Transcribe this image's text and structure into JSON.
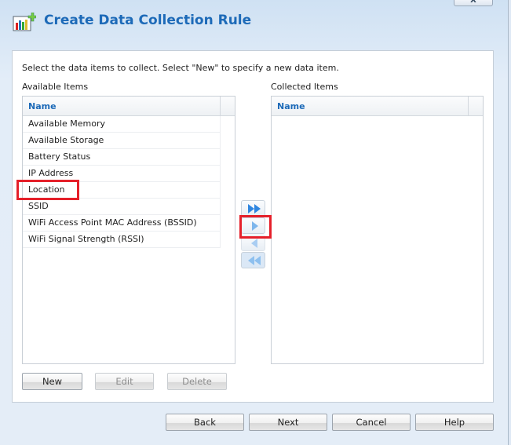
{
  "dialog": {
    "title": "Create Data Collection Rule",
    "close_label": "X",
    "app_icon": "chart-add-icon"
  },
  "instruction": "Select the data items to collect. Select \"New\" to specify a new data item.",
  "available": {
    "label": "Available Items",
    "column": "Name",
    "items": [
      "Available Memory",
      "Available Storage",
      "Battery Status",
      "IP Address",
      "Location",
      "SSID",
      "WiFi Access Point MAC Address (BSSID)",
      "WiFi Signal Strength (RSSI)"
    ]
  },
  "collected": {
    "label": "Collected Items",
    "column": "Name",
    "items": []
  },
  "transfer": [
    "add-all-icon",
    "add-icon",
    "remove-icon",
    "remove-all-icon"
  ],
  "list_buttons": {
    "new": "New",
    "edit": "Edit",
    "delete": "Delete"
  },
  "footer": {
    "back": "Back",
    "next": "Next",
    "cancel": "Cancel",
    "help": "Help"
  },
  "highlight_color": "#e5202a"
}
